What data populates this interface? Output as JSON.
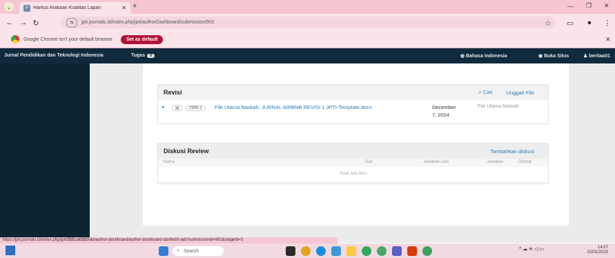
{
  "browser": {
    "tab_title": "Harkus Arakaan Kualitas Lapan",
    "url": "jpti.journals.id/index.php/jpti/authorDashboard/submission/902",
    "infobar_message": "Google Chrome isn't your default browser",
    "set_default_label": "Set as default"
  },
  "site": {
    "journal_name": "Jurnal Pendidikan dan Teknologi Indonesia",
    "tasks_label": "Tugas",
    "tasks_count": "0",
    "language_label": "Bahasa Indonesia",
    "view_site_label": "Buka Situs",
    "user_label": "beritaa01"
  },
  "revisi": {
    "title": "Revisi",
    "search_label": "Cari",
    "upload_label": "Unggah File",
    "file": {
      "id": "2906-1",
      "name": "File Utama Naskah, JURNAL AIRBNB REVISI 1 JPTI-Template.docx",
      "date_line1": "December",
      "date_line2": "7, 2024",
      "type": "File Utama Naskah"
    }
  },
  "diskusi": {
    "title": "Diskusi Review",
    "add_label": "Tambahkan diskusi",
    "columns": [
      "Nama",
      "Dari",
      "Jawaban Lalu",
      "Jawaban",
      "Ditutup"
    ],
    "empty": "Tidak Ada Item"
  },
  "status_url": "https://jpti.journals.id/index.php/jpti/$$$call$$$/tab/author-dashboard/author-dashboard-tab/fetch-tab?submissionId=902&stageId=3",
  "taskbar": {
    "search_placeholder": "Search",
    "time": "14:07",
    "date": "02/01/2025"
  }
}
